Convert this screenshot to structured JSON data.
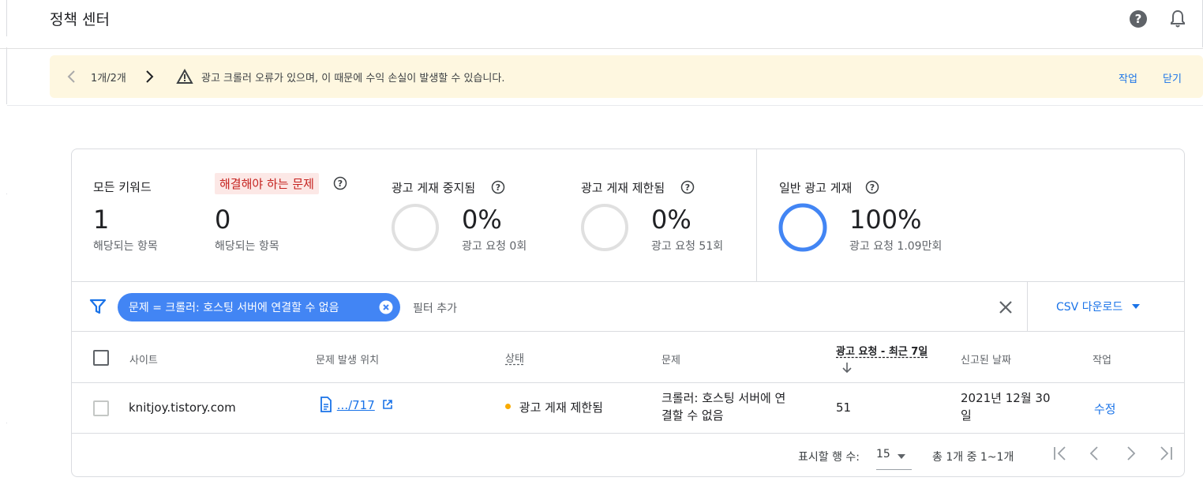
{
  "app": {
    "title": "정책 센터"
  },
  "banner": {
    "counter": "1개/2개",
    "message": "광고 크롤러 오류가 있으며, 이 때문에 수익 손실이 발생할 수 있습니다.",
    "action_label": "작업",
    "close_label": "닫기"
  },
  "stats": {
    "all": {
      "label": "모든 키워드",
      "value": "1",
      "sub": "해당되는 항목"
    },
    "issues": {
      "label": "해결해야 하는 문제",
      "value": "0",
      "sub": "해당되는 항목"
    },
    "suspended": {
      "label": "광고 게재 중지됨",
      "percent": "0%",
      "sub": "광고 요청 0회",
      "fraction": 0
    },
    "limited": {
      "label": "광고 게재 제한됨",
      "percent": "0%",
      "sub": "광고 요청 51회",
      "fraction": 0
    },
    "normal": {
      "label": "일반 광고 게재",
      "percent": "100%",
      "sub": "광고 요청 1.09만회",
      "fraction": 1
    }
  },
  "filter": {
    "chip": "문제 = 크롤러: 호스팅 서버에 연결할 수 없음",
    "add": "필터 추가",
    "csv": "CSV 다운로드"
  },
  "table": {
    "headers": {
      "site": "사이트",
      "location": "문제 발생 위치",
      "status": "상태",
      "issue": "문제",
      "requests": "광고 요청 - 최근 7일",
      "reported": "신고된 날짜",
      "action": "작업"
    },
    "rows": [
      {
        "site": "knitjoy.tistory.com",
        "location": ".../717",
        "status": "광고 게재 제한됨",
        "issue_line1": "크롤러: 호스팅 서버에 연",
        "issue_line2": "결할 수 없음",
        "requests": "51",
        "reported_line1": "2021년 12월 30",
        "reported_line2": "일",
        "action": "수정"
      }
    ]
  },
  "pager": {
    "rows_label": "표시할 행 수:",
    "rows_value": "15",
    "range": "총 1개 중 1~1개"
  },
  "colors": {
    "accent": "#1a73e8",
    "chip": "#4285f4",
    "banner": "#fef7e0",
    "error_bg": "#fce8e6",
    "status_dot": "#f9ab00"
  }
}
